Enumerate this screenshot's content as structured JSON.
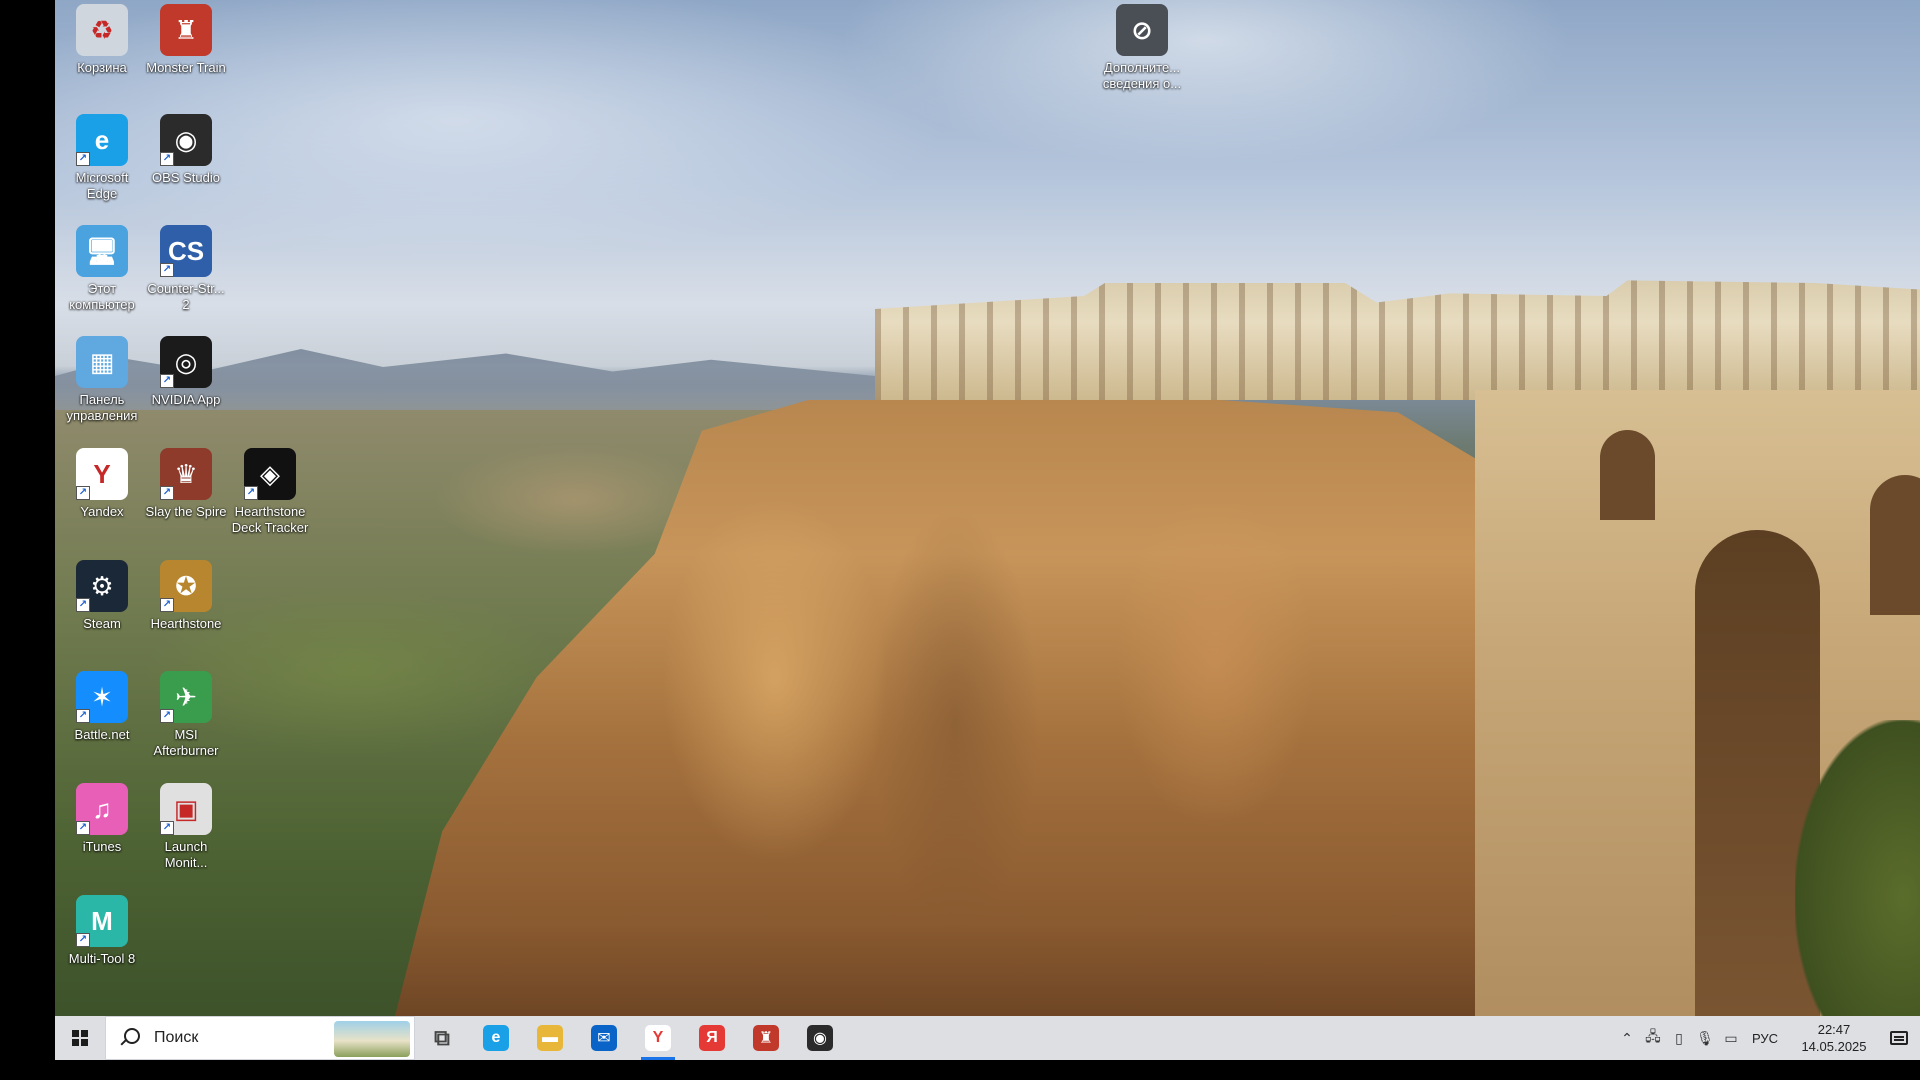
{
  "desktop_icons": [
    {
      "label": "Корзина",
      "icon": "recycle-bin-icon",
      "color": "#cfd6de",
      "glyph": "♻"
    },
    {
      "label": "Monster Train",
      "icon": "monster-train-icon",
      "color": "#c0392b",
      "glyph": "♜"
    },
    {
      "label": "Microsoft Edge",
      "icon": "edge-icon",
      "color": "#1aa0e6",
      "glyph": "e"
    },
    {
      "label": "OBS Studio",
      "icon": "obs-icon",
      "color": "#2b2b2b",
      "glyph": "◉"
    },
    {
      "label": "Этот компьютер",
      "icon": "this-pc-icon",
      "color": "#4aa3df",
      "glyph": "🖥"
    },
    {
      "label": "Counter-Str... 2",
      "icon": "counter-strike-icon",
      "color": "#2f5fa8",
      "glyph": "CS"
    },
    {
      "label": "Панель управления",
      "icon": "control-panel-icon",
      "color": "#5fa8e0",
      "glyph": "▦"
    },
    {
      "label": "NVIDIA App",
      "icon": "nvidia-icon",
      "color": "#1b1b1b",
      "glyph": "◎"
    },
    {
      "label": "Yandex",
      "icon": "yandex-browser-icon",
      "color": "#ffffff",
      "glyph": "Y"
    },
    {
      "label": "Slay the Spire",
      "icon": "slay-the-spire-icon",
      "color": "#8e3b2c",
      "glyph": "♛"
    },
    {
      "label": "Hearthstone Deck Tracker",
      "icon": "hearthstone-deck-tracker-icon",
      "color": "#111111",
      "glyph": "◈"
    },
    {
      "label": "Steam",
      "icon": "steam-icon",
      "color": "#1b2838",
      "glyph": "⚙"
    },
    {
      "label": "Hearthstone",
      "icon": "hearthstone-icon",
      "color": "#b8862e",
      "glyph": "✪"
    },
    {
      "label": "Battle.net",
      "icon": "battlenet-icon",
      "color": "#148eff",
      "glyph": "✶"
    },
    {
      "label": "MSI Afterburner",
      "icon": "msi-afterburner-icon",
      "color": "#3a9d4d",
      "glyph": "✈"
    },
    {
      "label": "iTunes",
      "icon": "itunes-icon",
      "color": "#e85fb8",
      "glyph": "♫"
    },
    {
      "label": "Launch Monit...",
      "icon": "launch-monitor-icon",
      "color": "#e0e0e0",
      "glyph": "▣"
    },
    {
      "label": "Multi-Tool 8",
      "icon": "multi-tool-icon",
      "color": "#2bb7a7",
      "glyph": "M"
    },
    {
      "label": "Дополните... сведения о...",
      "icon": "additional-info-icon",
      "color": "#4a4f55",
      "glyph": "⊘"
    }
  ],
  "taskbar": {
    "search_label": "Поиск",
    "pinned": [
      {
        "name": "task-view",
        "glyph": "⧉",
        "color": "#555555"
      },
      {
        "name": "edge",
        "glyph": "e",
        "color": "#1aa0e6"
      },
      {
        "name": "file-explorer",
        "glyph": "▬",
        "color": "#e8b73a"
      },
      {
        "name": "outlook",
        "glyph": "✉",
        "color": "#0a64c8"
      },
      {
        "name": "yandex-browser",
        "glyph": "Y",
        "color": "#ffffff",
        "active": true
      },
      {
        "name": "yandex",
        "glyph": "Я",
        "color": "#e53935"
      },
      {
        "name": "monster-train",
        "glyph": "♜",
        "color": "#c0392b"
      },
      {
        "name": "obs",
        "glyph": "◉",
        "color": "#2b2b2b"
      }
    ],
    "language": "РУС",
    "time": "22:47",
    "date": "14.05.2025"
  }
}
